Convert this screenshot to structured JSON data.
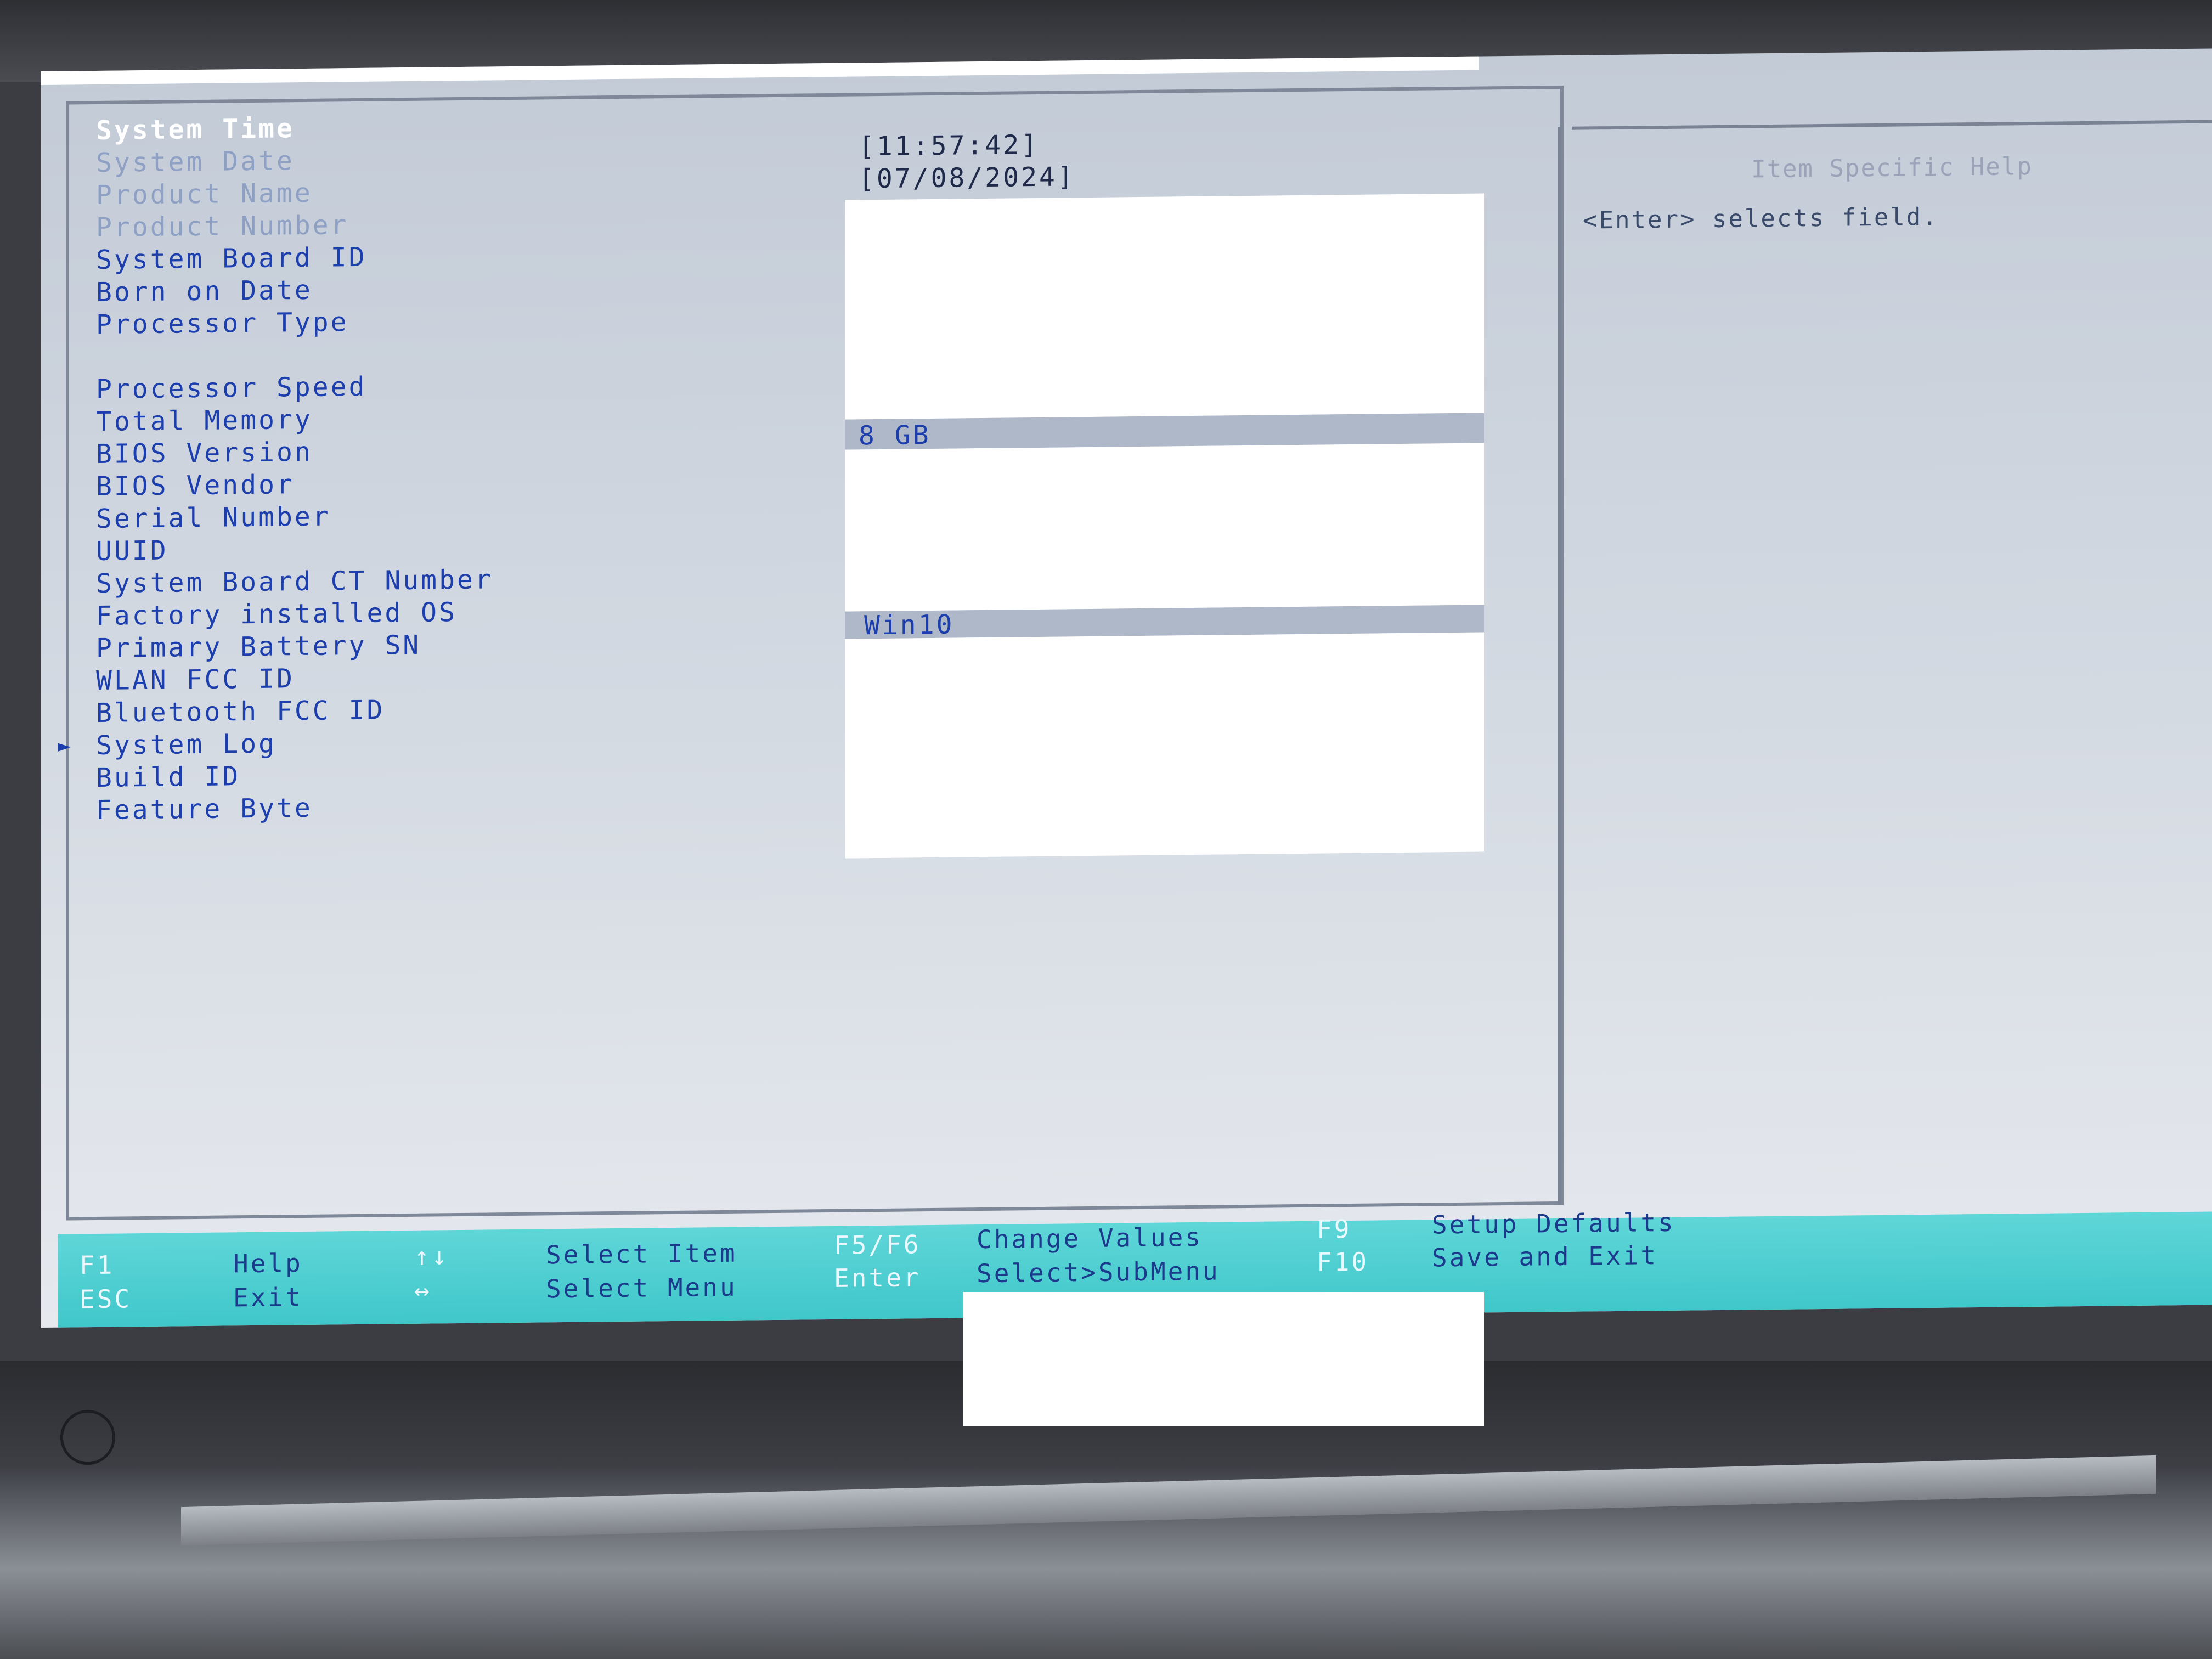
{
  "menu": {
    "items": [
      {
        "label": "System Time"
      },
      {
        "label": "System Date"
      },
      {
        "label": "Product Name"
      },
      {
        "label": "Product Number"
      },
      {
        "label": "System Board ID"
      },
      {
        "label": "Born on Date"
      },
      {
        "label": "Processor Type"
      },
      {
        "label": ""
      },
      {
        "label": "Processor Speed"
      },
      {
        "label": "Total Memory"
      },
      {
        "label": "BIOS Version"
      },
      {
        "label": "BIOS Vendor"
      },
      {
        "label": "Serial Number"
      },
      {
        "label": "UUID"
      },
      {
        "label": "System Board CT Number"
      },
      {
        "label": "Factory installed OS"
      },
      {
        "label": "Primary Battery SN"
      },
      {
        "label": "WLAN FCC ID"
      },
      {
        "label": "Bluetooth FCC ID"
      },
      {
        "label": "System Log"
      },
      {
        "label": "Build ID"
      },
      {
        "label": "Feature Byte"
      }
    ],
    "submenu_marker": "►"
  },
  "values": {
    "system_time": "[11:57:42]",
    "system_date": "[07/08/2024]",
    "total_memory": "8 GB",
    "factory_os": "Win10"
  },
  "help": {
    "title": "Item Specific Help",
    "text": "<Enter> selects field."
  },
  "statusbar": {
    "f1": "F1",
    "help": "Help",
    "esc": "ESC",
    "exit": "Exit",
    "updown": "↑↓",
    "select_item": "Select Item",
    "leftright": "↔",
    "select_menu": "Select Menu",
    "f5f6": "F5/F6",
    "change_values": "Change Values",
    "enter": "Enter",
    "select_submenu": "Select>SubMenu",
    "f9": "F9",
    "setup_defaults": "Setup Defaults",
    "f10": "F10",
    "save_exit": "Save and Exit"
  },
  "colors": {
    "screen_bg": "#c8d0db",
    "text_blue": "#1d3fae",
    "statusbar": "#4fcfd2"
  }
}
